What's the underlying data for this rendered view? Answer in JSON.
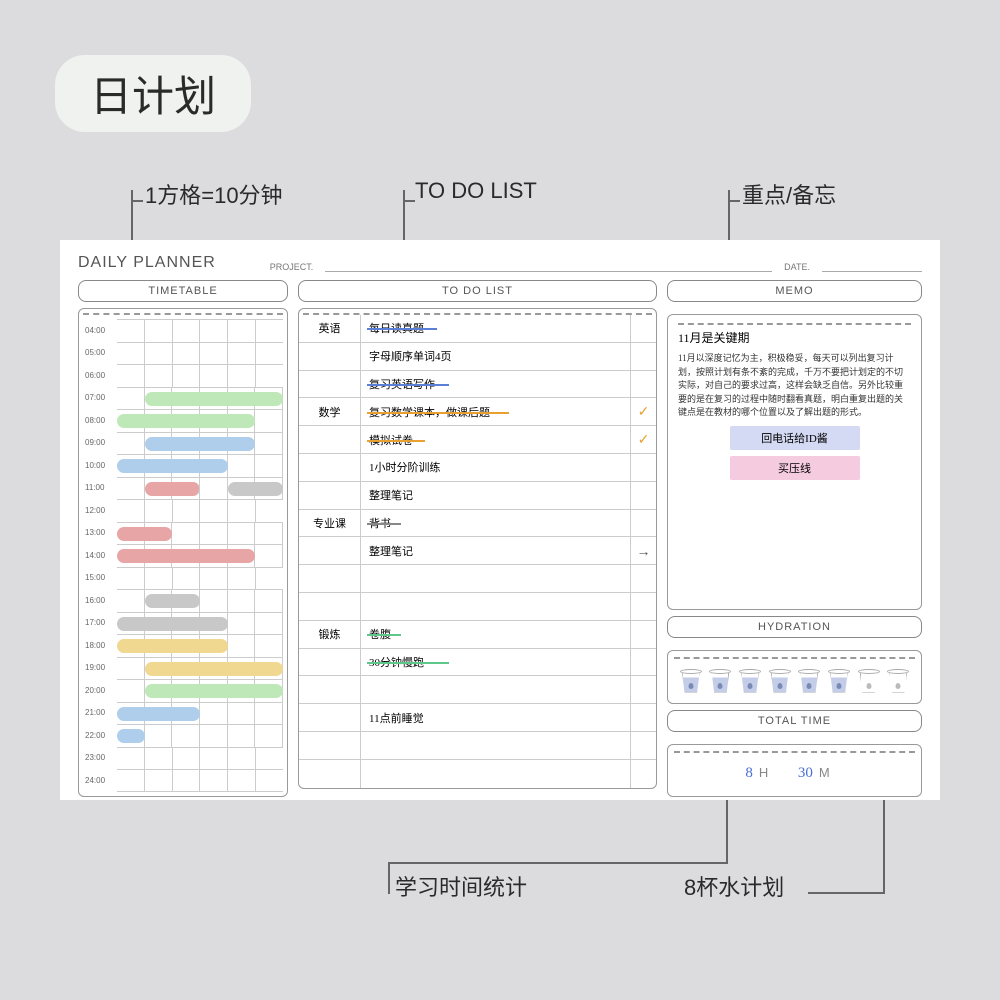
{
  "title": "日计划",
  "annotations": {
    "grid": "1方格=10分钟",
    "todo": "TO DO LIST",
    "memo": "重点/备忘",
    "total": "学习时间统计",
    "water": "8杯水计划"
  },
  "planner": {
    "title": "DAILY PLANNER",
    "project_label": "PROJECT.",
    "date_label": "DATE."
  },
  "sections": {
    "timetable": "TIMETABLE",
    "todo": "TO DO LIST",
    "memo": "MEMO",
    "hydration": "HYDRATION",
    "total": "TOTAL TIME"
  },
  "hours": [
    "04:00",
    "05:00",
    "06:00",
    "07:00",
    "08:00",
    "09:00",
    "10:00",
    "11:00",
    "12:00",
    "13:00",
    "14:00",
    "15:00",
    "16:00",
    "17:00",
    "18:00",
    "19:00",
    "20:00",
    "21:00",
    "22:00",
    "23:00",
    "24:00"
  ],
  "todos": [
    {
      "cat": "英语",
      "task": "每日读真题",
      "strike": "#5b7fd6",
      "check": ""
    },
    {
      "cat": "",
      "task": "字母顺序单词4页",
      "strike": "",
      "check": ""
    },
    {
      "cat": "",
      "task": "复习英语写作",
      "strike": "#5b7fd6",
      "check": ""
    },
    {
      "cat": "数学",
      "task": "复习数学课本，做课后题",
      "strike": "#e8a030",
      "check": "✓"
    },
    {
      "cat": "",
      "task": "模拟试卷",
      "strike": "#e8a030",
      "check": "✓"
    },
    {
      "cat": "",
      "task": "1小时分阶训练",
      "strike": "",
      "check": ""
    },
    {
      "cat": "",
      "task": "整理笔记",
      "strike": "",
      "check": ""
    },
    {
      "cat": "专业课",
      "task": "背书",
      "strike": "#888",
      "check": ""
    },
    {
      "cat": "",
      "task": "整理笔记",
      "strike": "",
      "check": "→"
    },
    {
      "cat": "",
      "task": "",
      "strike": "",
      "check": ""
    },
    {
      "cat": "",
      "task": "",
      "strike": "",
      "check": ""
    },
    {
      "cat": "锻炼",
      "task": "卷腹",
      "strike": "#5ec88a",
      "check": ""
    },
    {
      "cat": "",
      "task": "30分钟慢跑",
      "strike": "#5ec88a",
      "check": ""
    },
    {
      "cat": "",
      "task": "",
      "strike": "",
      "check": ""
    },
    {
      "cat": "",
      "task": "11点前睡觉",
      "strike": "",
      "check": ""
    },
    {
      "cat": "",
      "task": "",
      "strike": "",
      "check": ""
    },
    {
      "cat": "",
      "task": "",
      "strike": "",
      "check": ""
    }
  ],
  "memo": {
    "heading": "11月是关键期",
    "body": "11月以深度记忆为主，积极稳妥，每天可以列出复习计划，按照计划有条不紊的完成，千万不要把计划定的不切实际，对自己的要求过高，这样会缺乏自信。另外比较重要的是在复习的过程中随时翻看真题，明白重复出题的关键点是在教材的哪个位置以及了解出题的形式。",
    "tag1": "回电话给ID酱",
    "tag2": "买压线"
  },
  "hydration_filled": [
    true,
    true,
    true,
    true,
    true,
    true,
    false,
    false
  ],
  "total": {
    "hours": "8",
    "h": "H",
    "mins": "30",
    "m": "M"
  }
}
